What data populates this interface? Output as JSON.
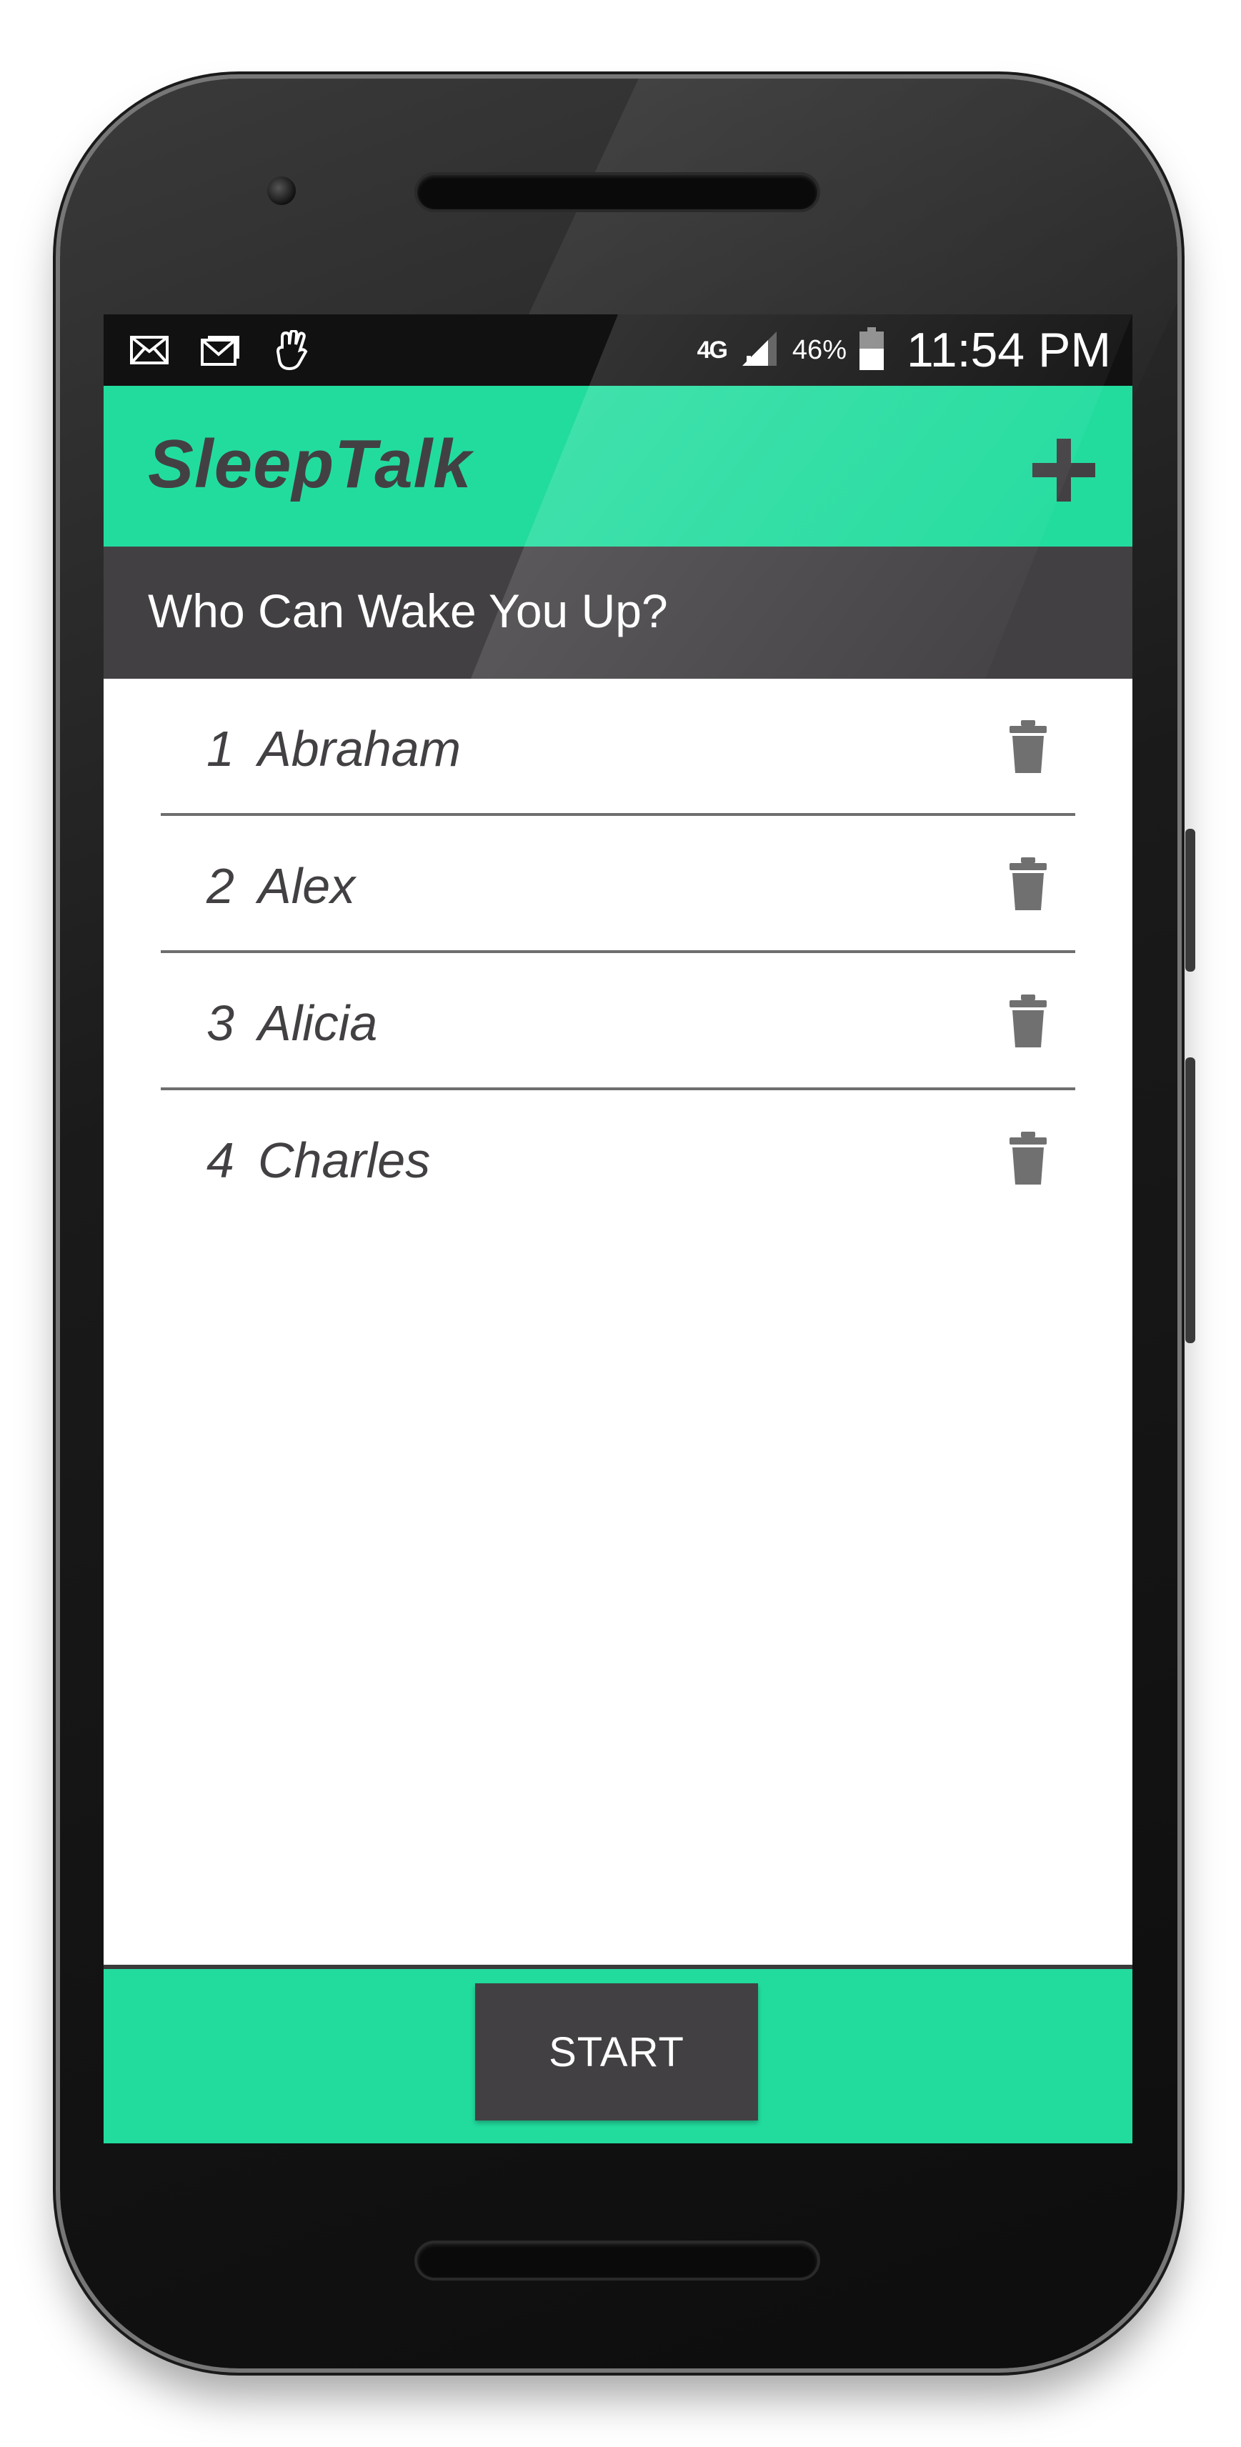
{
  "status_bar": {
    "left_icons": [
      "mail-icon",
      "gmail-icon",
      "hand-icon"
    ],
    "network": "4G",
    "signal_icon": "signal-bars-icon",
    "battery_percent": "46%",
    "battery_icon": "battery-icon",
    "time": "11:54 PM"
  },
  "app_bar": {
    "title": "SleepTalk",
    "add_icon": "plus-icon"
  },
  "subheader": {
    "text": "Who Can Wake You Up?"
  },
  "contacts": [
    {
      "number": "1",
      "name": "Abraham"
    },
    {
      "number": "2",
      "name": "Alex"
    },
    {
      "number": "3",
      "name": "Alicia"
    },
    {
      "number": "4",
      "name": "Charles"
    }
  ],
  "bottom_bar": {
    "start_label": "START"
  },
  "colors": {
    "accent": "#22dc9e",
    "dark": "#434043",
    "status_bar": "#111111",
    "icon_gray": "#707070"
  }
}
